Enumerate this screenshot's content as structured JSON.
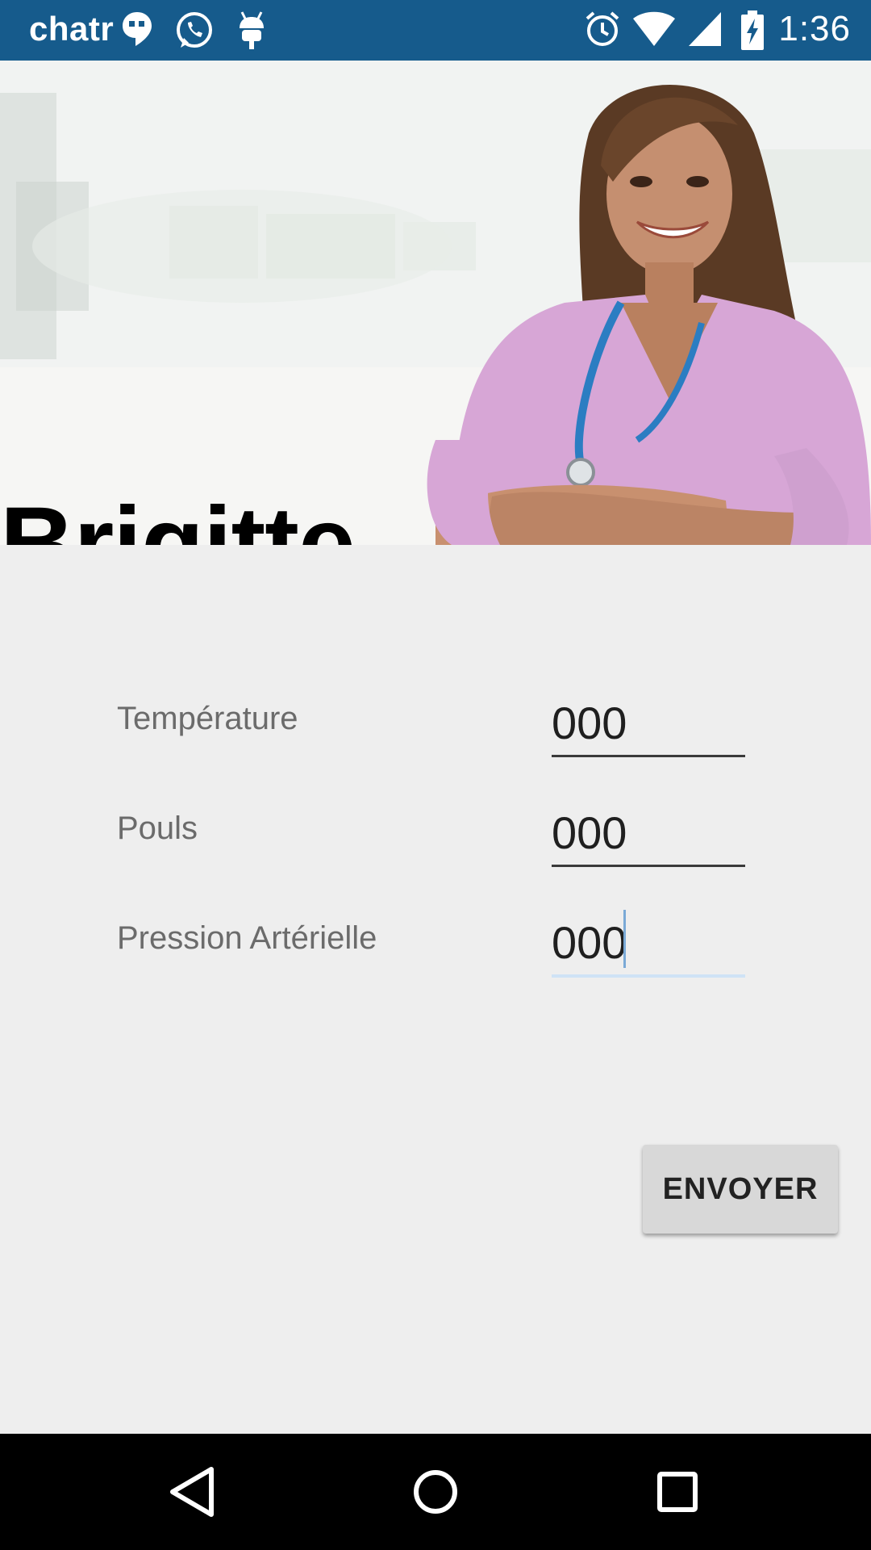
{
  "status_bar": {
    "carrier": "chatr",
    "time": "1:36",
    "icons": [
      "hangouts-icon",
      "whatsapp-icon",
      "android-debug-icon",
      "alarm-icon",
      "wifi-icon",
      "signal-icon",
      "battery-charging-icon"
    ]
  },
  "header": {
    "patient_name": "Brigitte",
    "image": "nurse-photo"
  },
  "form": {
    "fields": [
      {
        "label": "Température",
        "value": "000"
      },
      {
        "label": "Pouls",
        "value": "000"
      },
      {
        "label": "Pression Artérielle",
        "value": "000"
      }
    ],
    "submit_label": "ENVOYER"
  },
  "nav_bar": {
    "buttons": [
      "back-icon",
      "home-icon",
      "recents-icon"
    ]
  },
  "colors": {
    "status_bar": "#165b8c",
    "background": "#eeeeee",
    "button": "#d8d8d8",
    "focus_underline": "#cfe3f6"
  }
}
